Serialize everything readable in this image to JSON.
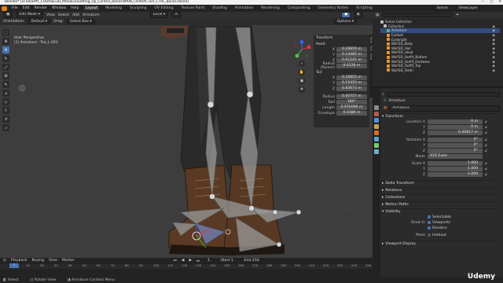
{
  "title_bar": {
    "title": "Blender* [D:\\UDEMY_COURSE\\3D_MODELS\\Setting_Up_Control_Bones\\MAIN_CHARACTER_CTRL_Bones.blend]",
    "buttons": [
      "—",
      "□",
      "✕"
    ]
  },
  "menu": {
    "items": [
      "File",
      "Edit",
      "Render",
      "Window",
      "Help"
    ],
    "workspaces": [
      "Layout",
      "Modeling",
      "Sculpting",
      "UV Editing",
      "Texture Paint",
      "Shading",
      "Animation",
      "Rendering",
      "Compositing",
      "Geometry Nodes",
      "Scripting"
    ],
    "active_workspace": "Layout",
    "scene": "Scene",
    "view_layer": "ViewLayer"
  },
  "viewport": {
    "mode": "Edit Mode",
    "menus": [
      "View",
      "Select",
      "Add",
      "Armature"
    ],
    "orientation_label": "Orientation:",
    "orientation": "Default",
    "drag_label": "Drag:",
    "drag": "Select Box",
    "transform_space": "Local",
    "options": "Options",
    "overlay_line1": "User Perspective",
    "overlay_line2": "(1) Armature : Toe_L.001"
  },
  "npanel": {
    "header": "Transform",
    "head_label": "Head:",
    "head": [
      {
        "label": "X",
        "value": "0.16655 m"
      },
      {
        "label": "Y",
        "value": "0.14485 m"
      },
      {
        "label": "Z",
        "value": "0.01241 m"
      },
      {
        "label": "Radius (Parent)",
        "value": "0.0126 m"
      }
    ],
    "tail_label": "Tail:",
    "tail": [
      {
        "label": "X",
        "value": "0.16655 m"
      },
      {
        "label": "Y",
        "value": "0.15455 m"
      },
      {
        "label": "Z",
        "value": "0.83673 m"
      }
    ],
    "extra": [
      {
        "label": "Radius",
        "value": "0.00757 m"
      },
      {
        "label": "Roll",
        "value": "180°"
      },
      {
        "label": "Length",
        "value": "0.970096 m"
      },
      {
        "label": "Envelope",
        "value": "0.0389 m"
      }
    ],
    "tabs": [
      "Item",
      "Tool",
      "View",
      "Create",
      "Screencast Keys"
    ]
  },
  "outliner": {
    "search_placeholder": "",
    "items": [
      {
        "label": "Scene Collection",
        "indent": 0,
        "color": "#bbbbbb",
        "selected": false
      },
      {
        "label": "Collection",
        "indent": 1,
        "color": "#bbbbbb",
        "selected": false
      },
      {
        "label": "Armature",
        "indent": 2,
        "color": "#4fbf7a",
        "selected": true
      },
      {
        "label": "Eyeball",
        "indent": 2,
        "color": "#e8973a",
        "selected": false
      },
      {
        "label": "Eyebright",
        "indent": 2,
        "color": "#e8973a",
        "selected": false
      },
      {
        "label": "Wolf3D_Body",
        "indent": 2,
        "color": "#e8973a",
        "selected": false
      },
      {
        "label": "Wolf3D_Hair",
        "indent": 2,
        "color": "#e8973a",
        "selected": false
      },
      {
        "label": "Wolf3D_Head",
        "indent": 2,
        "color": "#e8973a",
        "selected": false
      },
      {
        "label": "Wolf3D_Outfit_Bottom",
        "indent": 2,
        "color": "#e8973a",
        "selected": false
      },
      {
        "label": "Wolf3D_Outfit_Footwear",
        "indent": 2,
        "color": "#e8973a",
        "selected": false
      },
      {
        "label": "Wolf3D_Outfit_Top",
        "indent": 2,
        "color": "#e8973a",
        "selected": false
      },
      {
        "label": "Wolf3D_Teeth",
        "indent": 2,
        "color": "#e8973a",
        "selected": false
      }
    ]
  },
  "properties": {
    "object_name": "Armature",
    "data_name": "Armature",
    "transform_header": "Transform",
    "location_label": "Location X",
    "location": [
      {
        "label": "Location X",
        "value": "0 m"
      },
      {
        "label": "Y",
        "value": "0 m"
      },
      {
        "label": "Z",
        "value": "0.00817 m"
      }
    ],
    "rotation": [
      {
        "label": "Rotation X",
        "value": "0°"
      },
      {
        "label": "Y",
        "value": "0°"
      },
      {
        "label": "Z",
        "value": "0°"
      }
    ],
    "mode_label": "Mode",
    "mode_value": "XYZ Euler",
    "scale": [
      {
        "label": "Scale X",
        "value": "1.000"
      },
      {
        "label": "Y",
        "value": "1.000"
      },
      {
        "label": "Z",
        "value": "1.000"
      }
    ],
    "panels": [
      "Delta Transform",
      "Relations",
      "Collections",
      "Motion Paths"
    ],
    "visibility_header": "Visibility",
    "selectable": "Selectable",
    "show_in_label": "Show In",
    "viewports": "Viewports",
    "renders": "Renders",
    "mask_label": "Mask",
    "holdout": "Holdout",
    "viewport_display": "Viewport Display"
  },
  "timeline": {
    "menus": [
      "Playback",
      "Keying",
      "View",
      "Marker"
    ],
    "ticks": [
      "0",
      "10",
      "20",
      "30",
      "40",
      "50",
      "60",
      "70",
      "80",
      "90",
      "100",
      "110",
      "120",
      "130",
      "140",
      "150",
      "160",
      "170",
      "180",
      "190",
      "200",
      "210",
      "220",
      "230",
      "240",
      "250"
    ],
    "current_frame": "1",
    "start_label": "Start",
    "start": "1",
    "end_label": "End",
    "end": "250"
  },
  "status": {
    "items": [
      "Select",
      "Rotate View",
      "Armature Context Menu"
    ]
  },
  "watermark": "Udemy",
  "colors": {
    "accent": "#4772b3",
    "bone": "#9a9a9a",
    "bone_selected": "#7fa6ff",
    "background": "#3d3d3d"
  }
}
